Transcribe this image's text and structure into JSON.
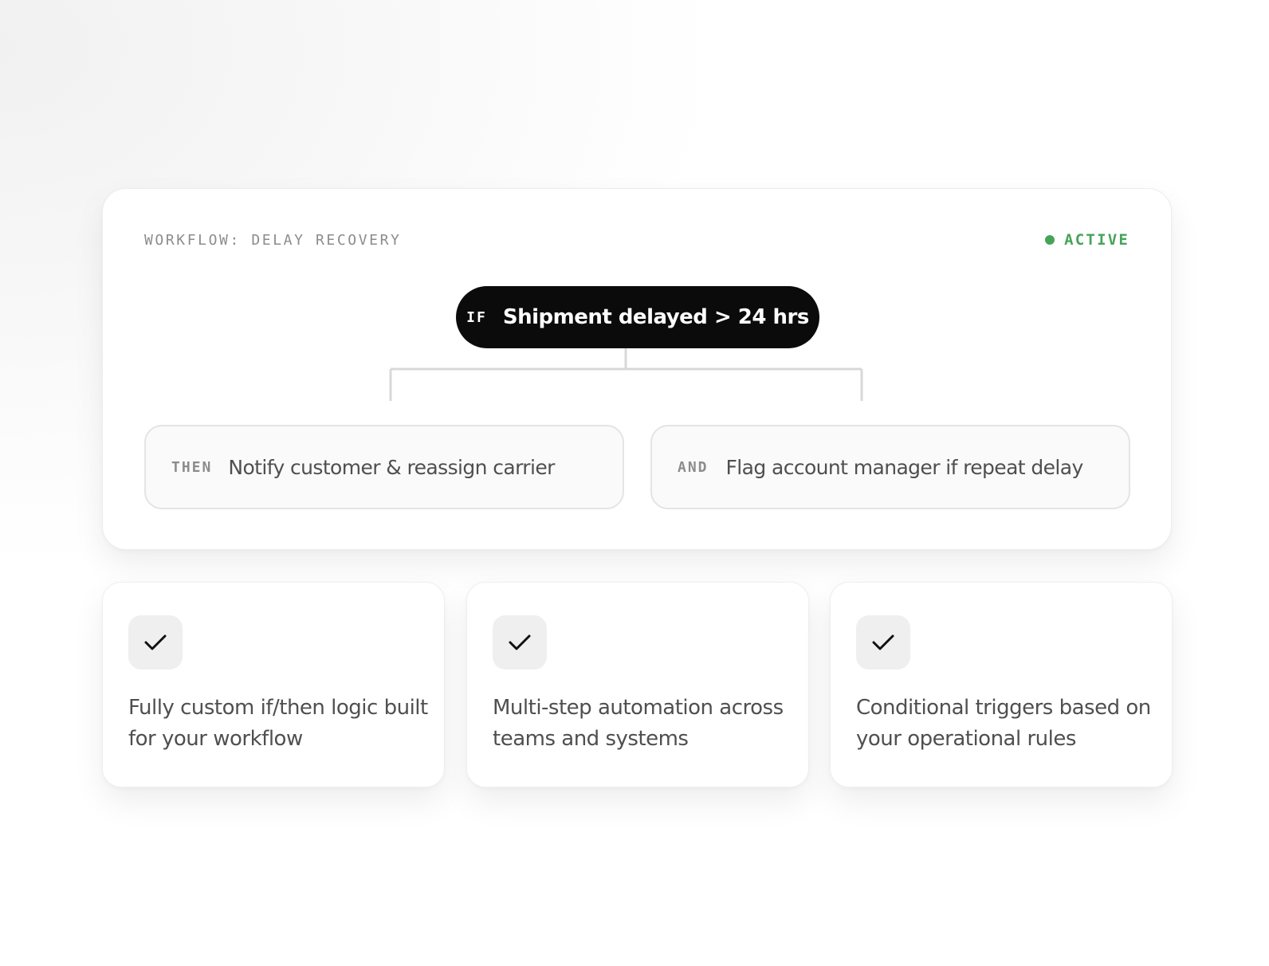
{
  "workflow": {
    "title": "WORKFLOW: DELAY RECOVERY",
    "status": {
      "label": "ACTIVE",
      "color": "#46a35a"
    },
    "condition": {
      "keyword": "IF",
      "text": "Shipment delayed > 24 hrs"
    },
    "actions": [
      {
        "keyword": "THEN",
        "text": "Notify customer & reassign carrier"
      },
      {
        "keyword": "AND",
        "text": "Flag account manager if repeat delay"
      }
    ]
  },
  "features": [
    {
      "icon": "checkmark-icon",
      "text": "Fully custom if/then logic built for your workflow"
    },
    {
      "icon": "checkmark-icon",
      "text": "Multi-step automation across teams and systems"
    },
    {
      "icon": "checkmark-icon",
      "text": "Conditional triggers based on your operational rules"
    }
  ]
}
